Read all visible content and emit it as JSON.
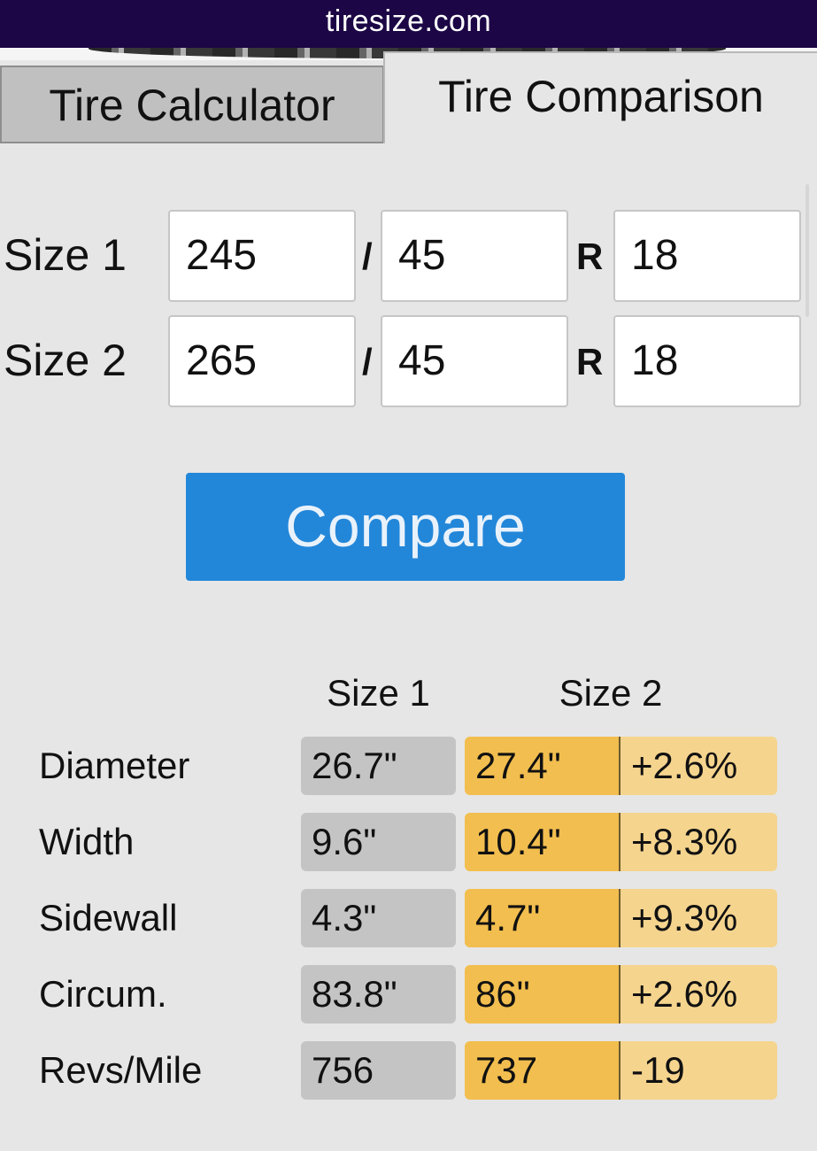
{
  "site": {
    "title": "tiresize.com"
  },
  "tabs": {
    "calculator": "Tire Calculator",
    "comparison": "Tire Comparison"
  },
  "inputs": {
    "size1": {
      "label": "Size 1",
      "width": "245",
      "aspect": "45",
      "rim": "18"
    },
    "size2": {
      "label": "Size 2",
      "width": "265",
      "aspect": "45",
      "rim": "18"
    },
    "slash": "/",
    "rim_letter": "R"
  },
  "compare_button": "Compare",
  "results": {
    "headers": [
      "Size 1",
      "Size 2"
    ],
    "rows": [
      {
        "label": "Diameter",
        "size1": "26.7\"",
        "size2": "27.4\"",
        "diff": "+2.6%"
      },
      {
        "label": "Width",
        "size1": "9.6\"",
        "size2": "10.4\"",
        "diff": "+8.3%"
      },
      {
        "label": "Sidewall",
        "size1": "4.3\"",
        "size2": "4.7\"",
        "diff": "+9.3%"
      },
      {
        "label": "Circum.",
        "size1": "83.8\"",
        "size2": "86\"",
        "diff": "+2.6%"
      },
      {
        "label": "Revs/Mile",
        "size1": "756",
        "size2": "737",
        "diff": "-19"
      }
    ]
  },
  "colors": {
    "topbar": "#1c0645",
    "button": "#2387d9",
    "size1_cell": "#c4c4c4",
    "size2_cell": "#f2be4f",
    "diff_cell": "#f5d48e"
  }
}
